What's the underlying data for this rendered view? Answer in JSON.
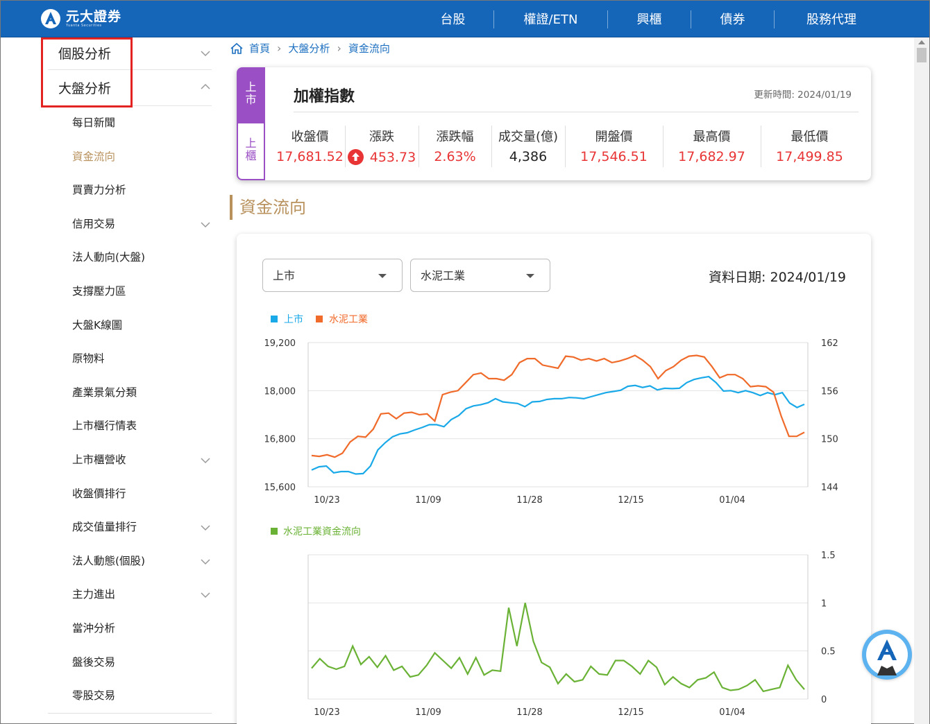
{
  "brand": {
    "name": "元大證券",
    "name_en": "Yuanta Securities"
  },
  "nav": {
    "items": [
      "台股",
      "權證/ETN",
      "興櫃",
      "債券",
      "股務代理"
    ]
  },
  "sidebar": {
    "top_items": [
      {
        "label": "個股分析",
        "expanded": false
      },
      {
        "label": "大盤分析",
        "expanded": true
      }
    ],
    "sub_items": [
      {
        "label": "每日新聞",
        "chevron": false,
        "active": false
      },
      {
        "label": "資金流向",
        "chevron": false,
        "active": true
      },
      {
        "label": "買賣力分析",
        "chevron": false,
        "active": false
      },
      {
        "label": "信用交易",
        "chevron": true,
        "active": false
      },
      {
        "label": "法人動向(大盤)",
        "chevron": false,
        "active": false
      },
      {
        "label": "支撐壓力區",
        "chevron": false,
        "active": false
      },
      {
        "label": "大盤K線圖",
        "chevron": false,
        "active": false
      },
      {
        "label": "原物料",
        "chevron": false,
        "active": false
      },
      {
        "label": "產業景氣分類",
        "chevron": false,
        "active": false
      },
      {
        "label": "上市櫃行情表",
        "chevron": false,
        "active": false
      },
      {
        "label": "上市櫃營收",
        "chevron": true,
        "active": false
      },
      {
        "label": "收盤價排行",
        "chevron": false,
        "active": false
      },
      {
        "label": "成交值量排行",
        "chevron": true,
        "active": false
      },
      {
        "label": "法人動態(個股)",
        "chevron": true,
        "active": false
      },
      {
        "label": "主力進出",
        "chevron": true,
        "active": false
      },
      {
        "label": "當沖分析",
        "chevron": false,
        "active": false
      },
      {
        "label": "盤後交易",
        "chevron": false,
        "active": false
      },
      {
        "label": "零股交易",
        "chevron": false,
        "active": false
      }
    ]
  },
  "breadcrumb": [
    "首頁",
    "大盤分析",
    "資金流向"
  ],
  "index_card": {
    "tab_listed": "上市",
    "tab_otc": "上櫃",
    "title": "加權指數",
    "update_time": "更新時間: 2024/01/19",
    "columns": [
      {
        "header": "收盤價",
        "value": "17,681.52",
        "color": "red"
      },
      {
        "header": "漲跌",
        "value": "453.73",
        "color": "red",
        "arrow": "up"
      },
      {
        "header": "漲跌幅",
        "value": "2.63%",
        "color": "red"
      },
      {
        "header": "成交量(億)",
        "value": "4,386",
        "color": "black"
      },
      {
        "header": "開盤價",
        "value": "17,546.51",
        "color": "red"
      },
      {
        "header": "最高價",
        "value": "17,682.97",
        "color": "red"
      },
      {
        "header": "最低價",
        "value": "17,499.85",
        "color": "red"
      }
    ]
  },
  "section_title": "資金流向",
  "filters": {
    "market": "上市",
    "industry": "水泥工業",
    "data_date": "資料日期: 2024/01/19"
  },
  "colors": {
    "blue": "#1aa9e8",
    "orange": "#f06a2a",
    "green": "#6ab235",
    "red": "#e83434",
    "gold": "#b8915d",
    "purple": "#9b4fc5",
    "nav": "#1565b8"
  },
  "chart_data": [
    {
      "type": "line",
      "x_ticks": [
        "10/23",
        "11/09",
        "11/28",
        "12/15",
        "01/04"
      ],
      "series": [
        {
          "name": "上市",
          "axis": "left",
          "values": [
            16020,
            16100,
            16120,
            15950,
            15980,
            15980,
            15920,
            15930,
            16120,
            16520,
            16700,
            16850,
            16920,
            16950,
            17020,
            17080,
            17150,
            17150,
            17100,
            17280,
            17380,
            17550,
            17620,
            17650,
            17700,
            17800,
            17720,
            17700,
            17680,
            17600,
            17720,
            17730,
            17780,
            17800,
            17800,
            17830,
            17820,
            17800,
            17850,
            17900,
            17950,
            17980,
            18010,
            18110,
            18130,
            18080,
            18120,
            18020,
            18060,
            18050,
            18060,
            18200,
            18280,
            18320,
            18350,
            18200,
            17990,
            18000,
            17950,
            18000,
            17950,
            17880,
            17950,
            17900,
            17950,
            17690,
            17580,
            17660
          ]
        },
        {
          "name": "水泥工業",
          "axis": "right",
          "values": [
            147.9,
            147.8,
            148.0,
            147.7,
            148.2,
            149.6,
            150.3,
            150.2,
            151.2,
            153.1,
            153.2,
            152.5,
            153.2,
            153.3,
            153.0,
            153.1,
            152.2,
            155.5,
            155.8,
            156.0,
            157.0,
            158.0,
            158.2,
            157.5,
            157.5,
            157.3,
            158.0,
            159.5,
            160.0,
            160.0,
            159.2,
            159.0,
            158.8,
            160.3,
            160.2,
            159.8,
            160.0,
            159.7,
            160.0,
            159.5,
            159.7,
            160.0,
            160.4,
            159.8,
            159.0,
            157.5,
            158.5,
            159.0,
            159.8,
            160.3,
            160.4,
            160.2,
            159.0,
            157.6,
            158.0,
            158.0,
            157.5,
            156.5,
            156.6,
            156.5,
            155.8,
            152.8,
            150.3,
            150.3,
            150.8
          ]
        }
      ],
      "y_left": {
        "ticks": [
          15600,
          16800,
          18000,
          19200
        ],
        "range": [
          15600,
          19200
        ]
      },
      "y_right": {
        "ticks": [
          144,
          150,
          156,
          162
        ],
        "range": [
          144,
          162
        ]
      },
      "grid": true,
      "legend": "top-left"
    },
    {
      "type": "line",
      "x_ticks": [
        "10/23",
        "11/09",
        "11/28",
        "12/15",
        "01/04"
      ],
      "series": [
        {
          "name": "水泥工業資金流向",
          "axis": "right",
          "values": [
            0.32,
            0.42,
            0.34,
            0.31,
            0.34,
            0.55,
            0.36,
            0.44,
            0.33,
            0.45,
            0.3,
            0.34,
            0.23,
            0.25,
            0.35,
            0.48,
            0.4,
            0.32,
            0.43,
            0.26,
            0.43,
            0.25,
            0.3,
            0.29,
            0.95,
            0.55,
            1.0,
            0.6,
            0.38,
            0.33,
            0.16,
            0.26,
            0.18,
            0.2,
            0.34,
            0.26,
            0.25,
            0.4,
            0.4,
            0.34,
            0.26,
            0.4,
            0.33,
            0.15,
            0.23,
            0.16,
            0.12,
            0.2,
            0.22,
            0.28,
            0.12,
            0.09,
            0.1,
            0.14,
            0.2,
            0.08,
            0.1,
            0.12,
            0.35,
            0.2,
            0.1
          ]
        }
      ],
      "y_right": {
        "ticks": [
          0,
          0.5,
          1,
          1.5
        ],
        "range": [
          0,
          1.5
        ]
      },
      "grid": true,
      "legend": "top-left"
    }
  ]
}
